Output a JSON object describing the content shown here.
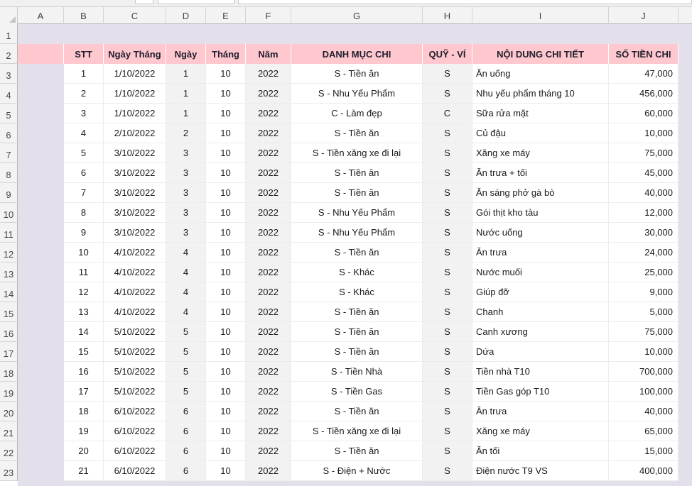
{
  "columns": [
    "A",
    "B",
    "C",
    "D",
    "E",
    "F",
    "G",
    "H",
    "I",
    "J"
  ],
  "rows": [
    "1",
    "2",
    "3",
    "4",
    "5",
    "6",
    "7",
    "8",
    "9",
    "10",
    "11",
    "12",
    "13",
    "14",
    "15",
    "16",
    "17",
    "18",
    "19",
    "20",
    "21",
    "22",
    "23"
  ],
  "header": {
    "stt": "STT",
    "ngay_thang": "Ngày Tháng",
    "ngay": "Ngày",
    "thang": "Tháng",
    "nam": "Năm",
    "danh_muc": "DANH MỤC CHI",
    "quy_vi": "QUỸ - VÍ",
    "noi_dung": "NỘI DUNG CHI TIẾT",
    "so_tien": "SỐ TIỀN CHI"
  },
  "records": [
    [
      "1",
      "1/10/2022",
      "1",
      "10",
      "2022",
      "S - Tiền ăn",
      "S",
      "Ăn uống",
      "47,000"
    ],
    [
      "2",
      "1/10/2022",
      "1",
      "10",
      "2022",
      "S - Nhu Yếu Phẩm",
      "S",
      "Nhu yếu phẩm tháng 10",
      "456,000"
    ],
    [
      "3",
      "1/10/2022",
      "1",
      "10",
      "2022",
      "C - Làm đẹp",
      "C",
      "Sữa rửa mặt",
      "60,000"
    ],
    [
      "4",
      "2/10/2022",
      "2",
      "10",
      "2022",
      "S - Tiền ăn",
      "S",
      "Củ đậu",
      "10,000"
    ],
    [
      "5",
      "3/10/2022",
      "3",
      "10",
      "2022",
      "S - Tiền xăng xe đi lại",
      "S",
      "Xăng xe máy",
      "75,000"
    ],
    [
      "6",
      "3/10/2022",
      "3",
      "10",
      "2022",
      "S - Tiền ăn",
      "S",
      "Ăn trưa + tối",
      "45,000"
    ],
    [
      "7",
      "3/10/2022",
      "3",
      "10",
      "2022",
      "S - Tiền ăn",
      "S",
      "Ăn sáng phở gà bò",
      "40,000"
    ],
    [
      "8",
      "3/10/2022",
      "3",
      "10",
      "2022",
      "S - Nhu Yếu Phẩm",
      "S",
      "Gói thịt kho tàu",
      "12,000"
    ],
    [
      "9",
      "3/10/2022",
      "3",
      "10",
      "2022",
      "S - Nhu Yếu Phẩm",
      "S",
      "Nước uống",
      "30,000"
    ],
    [
      "10",
      "4/10/2022",
      "4",
      "10",
      "2022",
      "S - Tiền ăn",
      "S",
      "Ăn trưa",
      "24,000"
    ],
    [
      "11",
      "4/10/2022",
      "4",
      "10",
      "2022",
      "S - Khác",
      "S",
      "Nước muối",
      "25,000"
    ],
    [
      "12",
      "4/10/2022",
      "4",
      "10",
      "2022",
      "S - Khác",
      "S",
      "Giúp đỡ",
      "9,000"
    ],
    [
      "13",
      "4/10/2022",
      "4",
      "10",
      "2022",
      "S - Tiền ăn",
      "S",
      "Chanh",
      "5,000"
    ],
    [
      "14",
      "5/10/2022",
      "5",
      "10",
      "2022",
      "S - Tiền ăn",
      "S",
      "Canh xương",
      "75,000"
    ],
    [
      "15",
      "5/10/2022",
      "5",
      "10",
      "2022",
      "S - Tiền ăn",
      "S",
      "Dứa",
      "10,000"
    ],
    [
      "16",
      "5/10/2022",
      "5",
      "10",
      "2022",
      "S - Tiền Nhà",
      "S",
      "Tiền nhà T10",
      "700,000"
    ],
    [
      "17",
      "5/10/2022",
      "5",
      "10",
      "2022",
      "S - Tiền Gas",
      "S",
      "Tiền Gas góp T10",
      "100,000"
    ],
    [
      "18",
      "6/10/2022",
      "6",
      "10",
      "2022",
      "S - Tiền ăn",
      "S",
      "Ăn trưa",
      "40,000"
    ],
    [
      "19",
      "6/10/2022",
      "6",
      "10",
      "2022",
      "S - Tiền xăng xe đi lại",
      "S",
      "Xăng xe máy",
      "65,000"
    ],
    [
      "20",
      "6/10/2022",
      "6",
      "10",
      "2022",
      "S - Tiền ăn",
      "S",
      "Ăn tối",
      "15,000"
    ],
    [
      "21",
      "6/10/2022",
      "6",
      "10",
      "2022",
      "S - Điện + Nước",
      "S",
      "Điện nước T9 VS",
      "400,000"
    ]
  ]
}
